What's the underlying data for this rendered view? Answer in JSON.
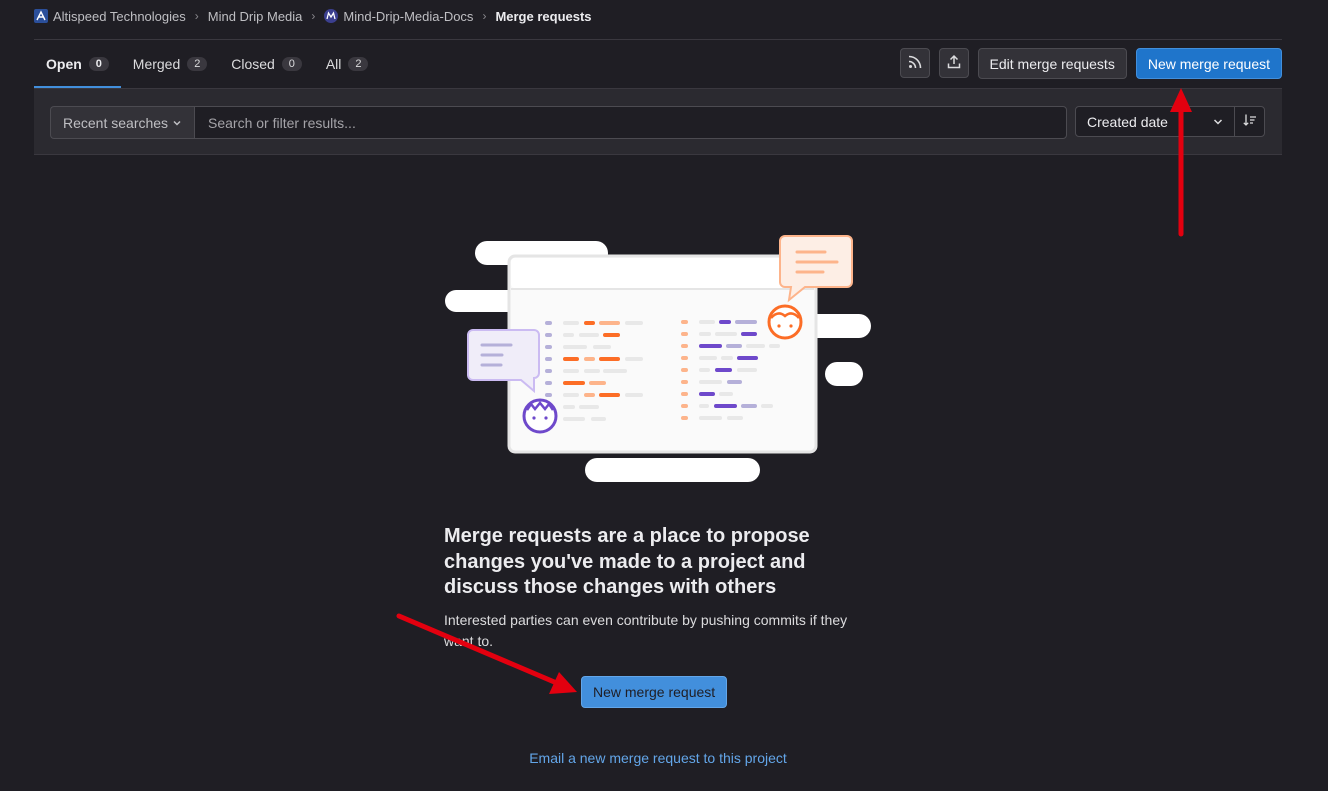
{
  "breadcrumb": {
    "items": [
      {
        "label": "Altispeed Technologies",
        "icon": "altispeed-logo-icon"
      },
      {
        "label": "Mind Drip Media"
      },
      {
        "label": "Mind-Drip-Media-Docs",
        "icon": "project-avatar-icon"
      },
      {
        "label": "Merge requests"
      }
    ]
  },
  "tabs": [
    {
      "label": "Open",
      "count": "0",
      "active": true
    },
    {
      "label": "Merged",
      "count": "2"
    },
    {
      "label": "Closed",
      "count": "0"
    },
    {
      "label": "All",
      "count": "2"
    }
  ],
  "toolbar": {
    "rss_icon": "rss-icon",
    "export_icon": "export-icon",
    "edit_label": "Edit merge requests",
    "new_label": "New merge request"
  },
  "filter": {
    "recent_label": "Recent searches",
    "search_placeholder": "Search or filter results...",
    "sort_label": "Created date",
    "sort_direction_icon": "sort-lowest-icon"
  },
  "empty_state": {
    "title": "Merge requests are a place to propose changes you've made to a project and discuss those changes with others",
    "description": "Interested parties can even contribute by pushing commits if they want to.",
    "button_label": "New merge request",
    "email_link": "Email a new merge request to this project"
  },
  "colors": {
    "background": "#1f1e24",
    "confirm_blue": "#1f75cb",
    "link_blue": "#63a6e9",
    "annotation_red": "#e3000f"
  }
}
